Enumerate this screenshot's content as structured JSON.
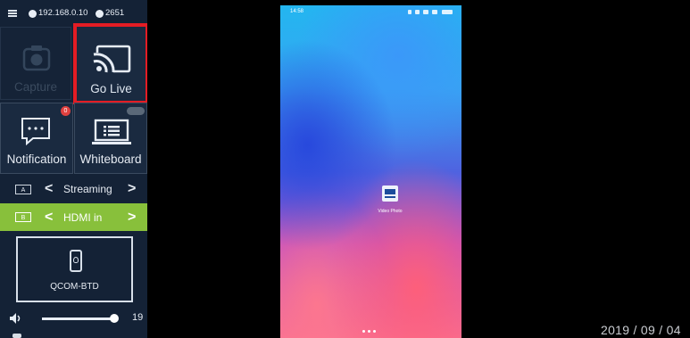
{
  "topbar": {
    "ip_address": "192.168.0.10",
    "port": "2651"
  },
  "tiles": {
    "capture": {
      "label": "Capture",
      "state": "disabled"
    },
    "go_live": {
      "label": "Go Live",
      "highlight_color": "#e41c24"
    },
    "notification": {
      "label": "Notification",
      "badge": "0"
    },
    "whiteboard": {
      "label": "Whiteboard"
    }
  },
  "sources": [
    {
      "key": "A",
      "label": "Streaming",
      "active": false
    },
    {
      "key": "B",
      "label": "HDMI in",
      "active": true,
      "color": "#88c03b"
    }
  ],
  "device": {
    "label": "QCOM-BTD",
    "icon": "phone-icon"
  },
  "volume": {
    "value": "19",
    "level": 1.0
  },
  "phone": {
    "status_time": "14:58",
    "app_label": "Video Photo",
    "page_dot_count": 3
  },
  "datestamp": "2019 / 09 / 04",
  "colors": {
    "panel": "#142236",
    "accent_green": "#88c03b",
    "highlight_red": "#e41c24"
  }
}
